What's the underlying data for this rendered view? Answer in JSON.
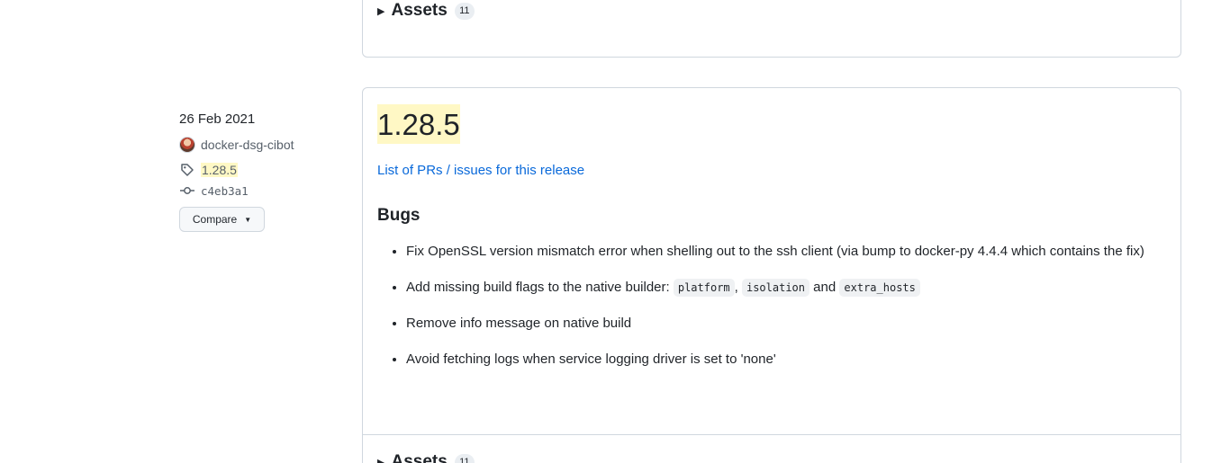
{
  "prev_release": {
    "assets_label": "Assets",
    "assets_count": "11"
  },
  "meta": {
    "date": "26 Feb 2021",
    "author": "docker-dsg-cibot",
    "tag": "1.28.5",
    "commit": "c4eb3a1",
    "compare_label": "Compare"
  },
  "release": {
    "title": "1.28.5",
    "link_text": "List of PRs / issues for this release",
    "section_heading": "Bugs",
    "bugs": {
      "item1": "Fix OpenSSL version mismatch error when shelling out to the ssh client (via bump to docker-py 4.4.4 which contains the fix)",
      "item2_prefix": "Add missing build flags to the native builder: ",
      "item2_code1": "platform",
      "item2_sep1": ",",
      "item2_code2": "isolation",
      "item2_sep2": " and ",
      "item2_code3": "extra_hosts",
      "item3": "Remove info message on native build",
      "item4": "Avoid fetching logs when service logging driver is set to 'none'"
    },
    "assets_label": "Assets",
    "assets_count": "11"
  },
  "icons": {
    "assets_toggle": "triangle-right-icon",
    "tag": "tag-icon",
    "commit": "git-commit-icon",
    "compare_caret": "caret-down-icon"
  },
  "colors": {
    "link": "#0969da",
    "highlight": "#fff8c5",
    "border": "#d0d7de"
  }
}
